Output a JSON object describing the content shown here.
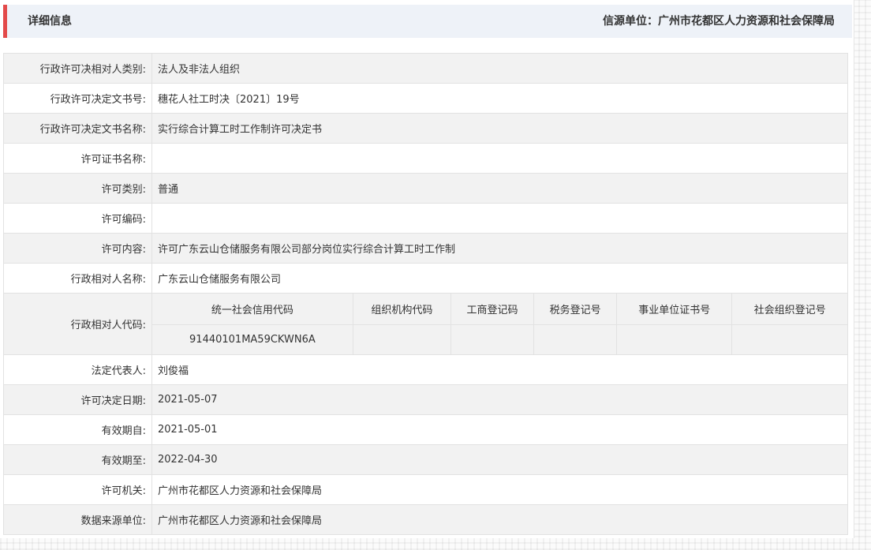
{
  "header": {
    "title": "详细信息",
    "source_label": "信源单位：广州市花都区人力资源和社会保障局"
  },
  "rows_top": [
    {
      "label": "行政许可决相对人类别:",
      "value": "法人及非法人组织"
    },
    {
      "label": "行政许可决定文书号:",
      "value": "穗花人社工时决〔2021〕19号"
    },
    {
      "label": "行政许可决定文书名称:",
      "value": "实行综合计算工时工作制许可决定书"
    },
    {
      "label": "许可证书名称:",
      "value": ""
    },
    {
      "label": "许可类别:",
      "value": "普通"
    },
    {
      "label": "许可编码:",
      "value": ""
    },
    {
      "label": "许可内容:",
      "value": "许可广东云山仓储服务有限公司部分岗位实行综合计算工时工作制"
    },
    {
      "label": "行政相对人名称:",
      "value": "广东云山仓储服务有限公司"
    }
  ],
  "code_row": {
    "label": "行政相对人代码:",
    "headers": [
      "统一社会信用代码",
      "组织机构代码",
      "工商登记码",
      "税务登记号",
      "事业单位证书号",
      "社会组织登记号"
    ],
    "values": [
      "91440101MA59CKWN6A",
      "",
      "",
      "",
      "",
      ""
    ]
  },
  "rows_bottom": [
    {
      "label": "法定代表人:",
      "value": "刘俊福"
    },
    {
      "label": "许可决定日期:",
      "value": "2021-05-07"
    },
    {
      "label": "有效期自:",
      "value": "2021-05-01"
    },
    {
      "label": "有效期至:",
      "value": "2022-04-30"
    },
    {
      "label": "许可机关:",
      "value": "广州市花都区人力资源和社会保障局"
    },
    {
      "label": "数据来源单位:",
      "value": "广州市花都区人力资源和社会保障局"
    }
  ]
}
